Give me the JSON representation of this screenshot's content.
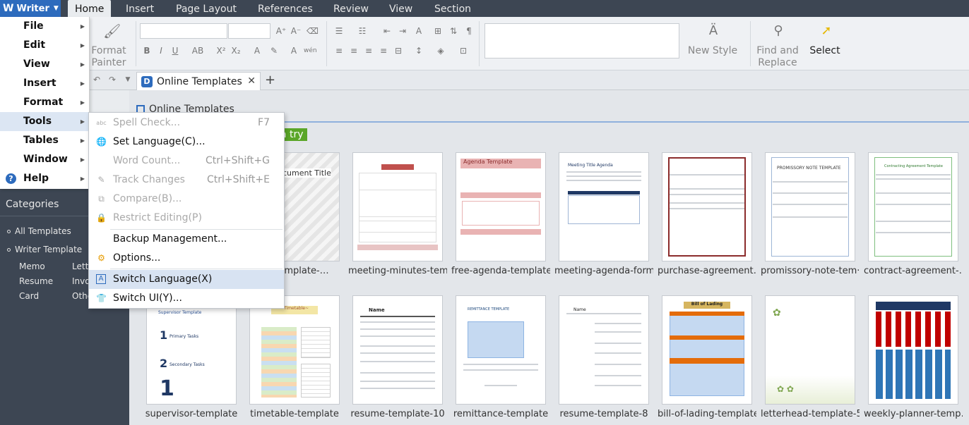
{
  "app": {
    "name": "Writer",
    "logo_glyph": "W"
  },
  "top_tabs": [
    "Home",
    "Insert",
    "Page Layout",
    "References",
    "Review",
    "View",
    "Section"
  ],
  "ribbon": {
    "format_painter": "Format Painter",
    "new_style": "New Style",
    "find_replace": "Find and Replace",
    "select": "Select",
    "bold": "B",
    "italic": "I",
    "underline": "U"
  },
  "doc_tab": {
    "title": "Online Templates",
    "close": "✕",
    "add": "+"
  },
  "main": {
    "subtab": "Online Templates",
    "try_button": "a try"
  },
  "templates_row1": [
    "ad-template-…",
    "meeting-minutes-tem·",
    "free-agenda-template",
    "meeting-agenda-form·",
    "purchase-agreement…",
    "promissory-note-tem·",
    "contract-agreement-…"
  ],
  "templates_row2": [
    "supervisor-template",
    "timetable-template",
    "resume-template-10",
    "remittance-template",
    "resume-template-8",
    "bill-of-lading-template",
    "letterhead-template-5",
    "weekly-planner-temp…"
  ],
  "thumb_text": {
    "document_title": "cument Title",
    "agenda": "Agenda Template",
    "supervisor": "Supervisor Template",
    "primary": "Primary Tasks",
    "secondary": "Secondary Tasks",
    "timetable": "~Timetable~",
    "remittance": "REMITTANCE TEMPLATE",
    "bill": "Bill of Lading",
    "promissory": "PROMISSORY NOTE TEMPLATE",
    "contract": "Contracting Agreement Template",
    "meeting_agenda": "Meeting Title Agenda",
    "name": "Name"
  },
  "sidebar": {
    "heading": "Categories",
    "all_templates": "All Templates",
    "writer_template": "Writer Template",
    "items": [
      {
        "left": "Memo",
        "right": "Lette"
      },
      {
        "left": "Resume",
        "right": "Invo"
      },
      {
        "left": "Card",
        "right": "Othe"
      }
    ]
  },
  "main_menu": [
    {
      "label": "File",
      "mnemonic": "F"
    },
    {
      "label": "Edit",
      "mnemonic": "E"
    },
    {
      "label": "View",
      "mnemonic": "V"
    },
    {
      "label": "Insert",
      "mnemonic": "I"
    },
    {
      "label": "Format",
      "mnemonic": "o"
    },
    {
      "label": "Tools",
      "mnemonic": "T"
    },
    {
      "label": "Tables",
      "mnemonic": "b"
    },
    {
      "label": "Window",
      "mnemonic": "W"
    },
    {
      "label": "Help",
      "mnemonic": "H"
    }
  ],
  "tools_menu": [
    {
      "label": "Spell Check...",
      "shortcut": "F7",
      "disabled": true,
      "icon": "abc"
    },
    {
      "label": "Set Language(C)...",
      "shortcut": "",
      "disabled": false,
      "icon": "globe"
    },
    {
      "label": "Word Count...",
      "shortcut": "Ctrl+Shift+G",
      "disabled": true,
      "icon": ""
    },
    {
      "label": "Track Changes",
      "shortcut": "Ctrl+Shift+E",
      "disabled": true,
      "icon": "track"
    },
    {
      "label": "Compare(B)...",
      "shortcut": "",
      "disabled": true,
      "icon": "compare"
    },
    {
      "label": "Restrict Editing(P)",
      "shortcut": "",
      "disabled": true,
      "icon": "lock"
    },
    {
      "label": "Backup Management...",
      "shortcut": "",
      "disabled": false,
      "icon": ""
    },
    {
      "label": "Options...",
      "shortcut": "",
      "disabled": false,
      "icon": "gear"
    },
    {
      "label": "Switch Language(X)",
      "shortcut": "",
      "disabled": false,
      "icon": "A"
    },
    {
      "label": "Switch UI(Y)...",
      "shortcut": "",
      "disabled": false,
      "icon": "shirt"
    }
  ],
  "colors": {
    "accent": "#2d6bbd",
    "topbar": "#3d4653",
    "try": "#5aa628"
  }
}
